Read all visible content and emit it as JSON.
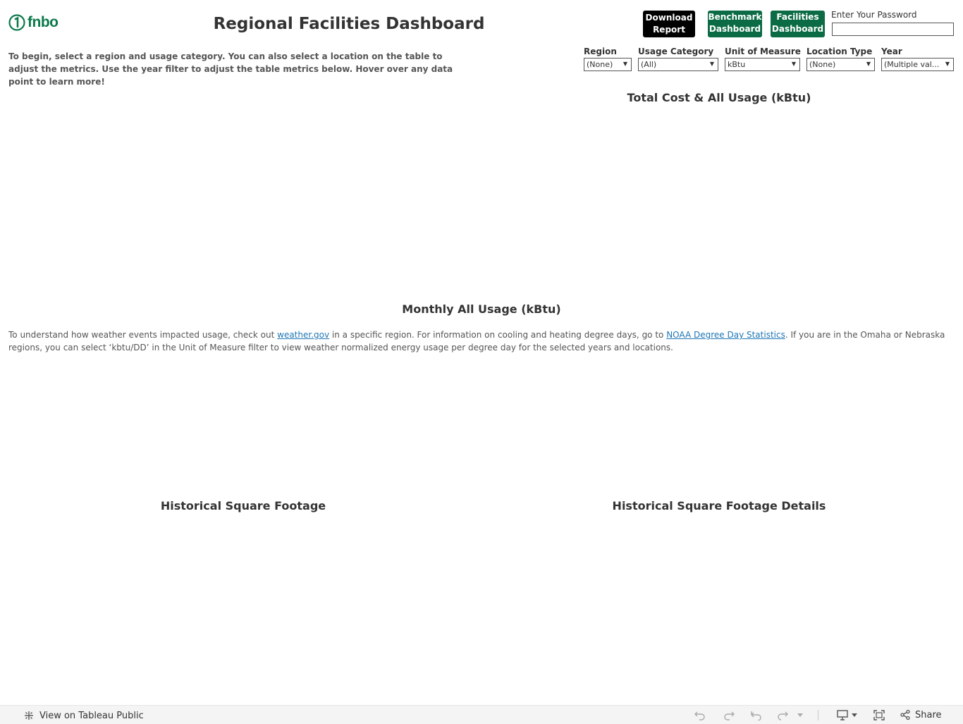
{
  "header": {
    "logo_text": "fnbo",
    "title": "Regional Facilities Dashboard",
    "buttons": {
      "download": [
        "Download",
        "Report"
      ],
      "benchmark": [
        "Benchmark",
        "Dashboard"
      ],
      "facilities": [
        "Facilities",
        "Dashboard"
      ]
    },
    "password_label": "Enter Your Password",
    "password_value": ""
  },
  "intro_text": "To begin, select a region and usage category. You can also select a location on the table to adjust the metrics. Use the year filter to adjust the table metrics below. Hover over any data point to learn more!",
  "filters": [
    {
      "label": "Region",
      "value": "(None)"
    },
    {
      "label": "Usage Category",
      "value": "(All)"
    },
    {
      "label": "Unit of Measure",
      "value": "kBtu"
    },
    {
      "label": "Location Type",
      "value": "(None)"
    },
    {
      "label": "Year",
      "value": "(Multiple val..."
    }
  ],
  "sections": {
    "total_cost": "Total Cost & All Usage (kBtu)",
    "monthly_usage": "Monthly All Usage (kBtu)",
    "hist_sqft": "Historical Square Footage",
    "hist_sqft_details": "Historical Square Footage Details"
  },
  "weather_note": {
    "part1": "To understand how weather events impacted usage, check out ",
    "link1": "weather.gov",
    "part2": " in a specific region. For information on cooling and heating degree days, go to ",
    "link2": "NOAA Degree Day Statistics",
    "part3": ". If you are in the Omaha or Nebraska regions, you can select ‘kbtu/DD’ in the Unit of Measure filter to view weather normalized energy usage per degree day for the selected years and locations."
  },
  "toolbar": {
    "view_on": "View on Tableau Public",
    "share": "Share"
  },
  "colors": {
    "brand_green": "#0b6b45",
    "logo_green": "#0b7a4b",
    "link_blue": "#1f77b4"
  }
}
